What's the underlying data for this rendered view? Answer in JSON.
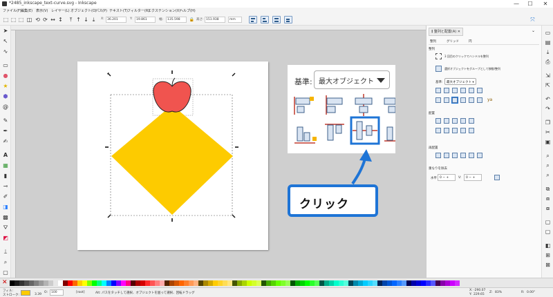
{
  "window": {
    "title": "*2485_inkscape_text-curve.svg - Inkscape",
    "minimize": "—",
    "maximize": "☐",
    "close": "✕"
  },
  "menu": [
    "ファイル(F)",
    "編集(E)",
    "表示(V)",
    "レイヤー(L)",
    "オブジェクト(O)",
    "パス(P)",
    "テキスト(T)",
    "フィルター(R)",
    "エクステンション(X)",
    "ヘルプ(H)"
  ],
  "toolbar": {
    "x_label": "X:",
    "x_value": "36.201",
    "y_label": "Y:",
    "y_value": "19.861",
    "w_label": "幅:",
    "w_value": "135.598",
    "h_label": "高さ:",
    "h_value": "151.938",
    "unit": "mm"
  },
  "zoom_panel": {
    "basis_label": "基準:",
    "basis_value": "最大オブジェクト"
  },
  "callout": {
    "text": "クリック"
  },
  "dock": {
    "header": "整列と配置(A)",
    "tab_align": "整列",
    "tab_grid": "グリッド",
    "tab_circle": "円",
    "section_align": "整列",
    "opt1": "3 回目のクリックでハンドルを整列",
    "opt2": "選択オブジェクトをグループとして移動/整列",
    "basis_label": "基準:",
    "basis_value": "最大オブジェクト",
    "section_distribute": "配置",
    "section_rearrange": "再配置",
    "section_overlap": "重なりを除去",
    "h_label": "水平",
    "h_value": "0",
    "v_label": "V:",
    "v_value": "0"
  },
  "status": {
    "fill_label": "フィル:",
    "stroke_label": "ストローク:",
    "stroke_width": "3.39",
    "opacity_label": "O:",
    "opacity": "100",
    "layer": "[root]",
    "message": "Alt: パスをタッチして選択、オブジェクトを囲って選択、回転ドラッグ",
    "x_label": "X:",
    "x_coord": "-290.07",
    "y_label": "Y:",
    "y_coord": "229.65",
    "zoom_label": "Z:",
    "zoom": "83%",
    "rot_label": "R:",
    "rotation": "0.00°"
  },
  "colors": {
    "diamond": "#fdcb00",
    "apple": "#f0544f",
    "callout_border": "#1e74d6",
    "arrow": "#1e74d6"
  },
  "palette": [
    "#000000",
    "#1a1a1a",
    "#333333",
    "#4d4d4d",
    "#666666",
    "#808080",
    "#999999",
    "#b3b3b3",
    "#cccccc",
    "#e6e6e6",
    "#ffffff",
    "#800000",
    "#ff0000",
    "#ff6600",
    "#ffcc00",
    "#ffff00",
    "#80ff00",
    "#00ff00",
    "#00ff80",
    "#00ffff",
    "#0080ff",
    "#0000ff",
    "#8000ff",
    "#ff00ff",
    "#ff0080",
    "#550000",
    "#aa0000",
    "#d40000",
    "#ff2a2a",
    "#ff5555",
    "#ff8080",
    "#ffaaaa",
    "#552200",
    "#aa4400",
    "#d45500",
    "#ff6600",
    "#ff7f2a",
    "#ff9955",
    "#ffb380",
    "#554400",
    "#aa8800",
    "#d4aa00",
    "#ffcc00",
    "#ffd42a",
    "#ffdd55",
    "#ffe680",
    "#445500",
    "#88aa00",
    "#aad400",
    "#ccff00",
    "#d4ff2a",
    "#ddff55",
    "#225500",
    "#44aa00",
    "#55d400",
    "#66ff00",
    "#7fff2a",
    "#99ff55",
    "#005500",
    "#00aa00",
    "#00d400",
    "#00ff00",
    "#2aff2a",
    "#55ff55",
    "#005544",
    "#00aa88",
    "#00d4aa",
    "#00ffcc",
    "#2affd5",
    "#55ffdd",
    "#004455",
    "#0088aa",
    "#00aad4",
    "#00ccff",
    "#2ad4ff",
    "#55ddff",
    "#002255",
    "#0044aa",
    "#0055d4",
    "#0066ff",
    "#2a7fff",
    "#5599ff",
    "#000055",
    "#0000aa",
    "#0000d4",
    "#0000ff",
    "#2a2aff",
    "#5555ff",
    "#440055",
    "#8800aa",
    "#aa00d4",
    "#cc00ff",
    "#d42aff"
  ]
}
